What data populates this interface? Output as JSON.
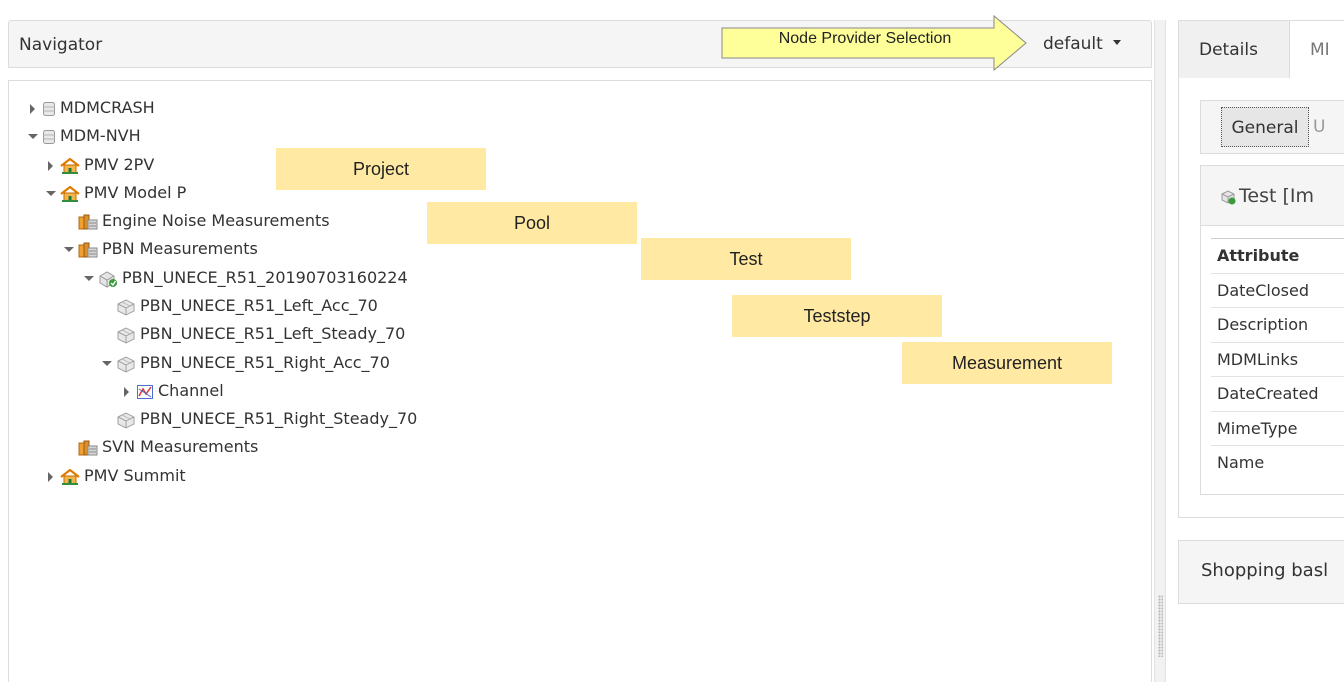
{
  "navigator": {
    "title": "Navigator",
    "provider_value": "default",
    "tree": [
      {
        "label": "MDMCRASH",
        "icon": "database-icon",
        "toggle": "closed"
      },
      {
        "label": "MDM-NVH",
        "icon": "database-icon",
        "toggle": "open"
      },
      {
        "label": "PMV 2PV",
        "icon": "project-icon",
        "toggle": "closed"
      },
      {
        "label": "PMV Model P",
        "icon": "project-icon",
        "toggle": "open"
      },
      {
        "label": "Engine Noise Measurements",
        "icon": "pool-icon",
        "toggle": "none"
      },
      {
        "label": "PBN Measurements",
        "icon": "pool-icon",
        "toggle": "open"
      },
      {
        "label": "PBN_UNECE_R51_20190703160224",
        "icon": "test-icon",
        "toggle": "open"
      },
      {
        "label": "PBN_UNECE_R51_Left_Acc_70",
        "icon": "teststep-icon",
        "toggle": "none"
      },
      {
        "label": "PBN_UNECE_R51_Left_Steady_70",
        "icon": "teststep-icon",
        "toggle": "none"
      },
      {
        "label": "PBN_UNECE_R51_Right_Acc_70",
        "icon": "teststep-icon",
        "toggle": "open"
      },
      {
        "label": "Channel",
        "icon": "channel-icon",
        "toggle": "closed"
      },
      {
        "label": "PBN_UNECE_R51_Right_Steady_70",
        "icon": "teststep-icon",
        "toggle": "none"
      },
      {
        "label": "SVN Measurements",
        "icon": "pool-icon",
        "toggle": "none"
      },
      {
        "label": "PMV Summit",
        "icon": "project-icon",
        "toggle": "closed"
      }
    ]
  },
  "annotations": {
    "node_provider": "Node Provider Selection",
    "project": "Project",
    "pool": "Pool",
    "test": "Test",
    "teststep": "Teststep",
    "measurement": "Measurement"
  },
  "details": {
    "tabs": [
      "Details",
      "MI"
    ],
    "subtabs": [
      "General",
      "U"
    ],
    "header": "Test [Im",
    "attribute_header": "Attribute",
    "attributes": [
      "DateClosed",
      "Description",
      "MDMLinks",
      "DateCreated",
      "MimeType",
      "Name"
    ],
    "shopping": "Shopping basl"
  },
  "colors": {
    "annotation_fill": "#ffe9a3",
    "arrow_fill": "#ffff99",
    "project_icon": "#e07b00",
    "pool_icon": "#d9902a"
  }
}
